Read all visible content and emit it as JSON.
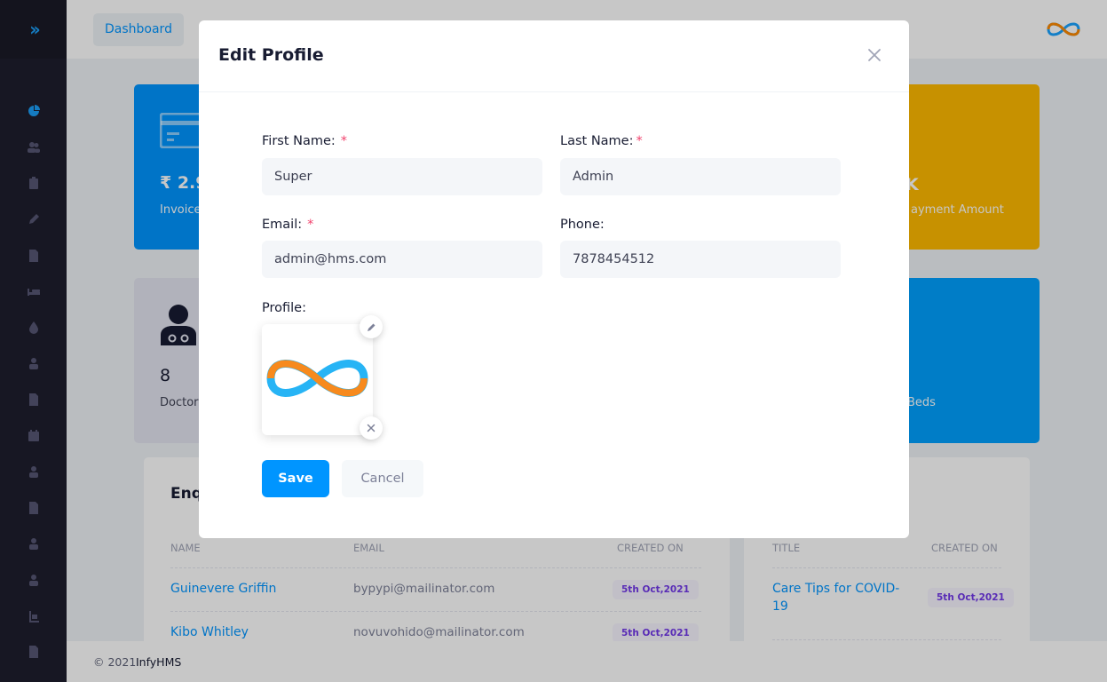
{
  "header": {
    "breadcrumb": "Dashboard"
  },
  "cards": {
    "invoice_amount": "₹ 2.9",
    "invoice_label": "Invoice",
    "payment_amount": "K",
    "payment_label": "ayment Amount",
    "doctors_count": "8",
    "doctors_label": "Doctor",
    "beds_label": "Beds"
  },
  "enquiries": {
    "title": "Enq",
    "columns": [
      "NAME",
      "EMAIL",
      "CREATED ON"
    ],
    "rows": [
      {
        "name": "Guinevere Griffin",
        "email": "bypypi@mailinator.com",
        "created": "5th Oct,2021"
      },
      {
        "name": "Kibo Whitley",
        "email": "novuvohido@mailinator.com",
        "created": "5th Oct,2021"
      }
    ]
  },
  "notices": {
    "columns": [
      "TITLE",
      "CREATED ON"
    ],
    "rows": [
      {
        "title_line1": "Care Tips for COVID-",
        "title_line2": "19",
        "created": "5th Oct,2021"
      }
    ]
  },
  "footer": {
    "copyright": "© 2021",
    "brand": "InfyHMS"
  },
  "modal": {
    "title": "Edit Profile",
    "first_name": {
      "label": "First Name:",
      "value": "Super"
    },
    "last_name": {
      "label": "Last Name:",
      "value": "Admin"
    },
    "email": {
      "label": "Email:",
      "value": "admin@hms.com"
    },
    "phone": {
      "label": "Phone:",
      "value": "7878454512"
    },
    "profile": {
      "label": "Profile:"
    },
    "required_mark": "*",
    "save_label": "Save",
    "cancel_label": "Cancel"
  },
  "colors": {
    "primary": "#0095ff",
    "sidebar": "#1e1e2d",
    "warning": "#ffba00",
    "danger": "#f1416c",
    "badge_text": "#7239ea"
  },
  "icons": {
    "sidebar": [
      "dashboard-icon",
      "users-icon",
      "clipboard-icon",
      "pen-icon",
      "file-icon",
      "bed-icon",
      "blood-drop-icon",
      "doctor-icon",
      "document-icon",
      "calendar-icon",
      "nurse-icon",
      "report-icon",
      "patient-icon",
      "user-icon",
      "pharmacy-icon",
      "file-text-icon"
    ]
  }
}
